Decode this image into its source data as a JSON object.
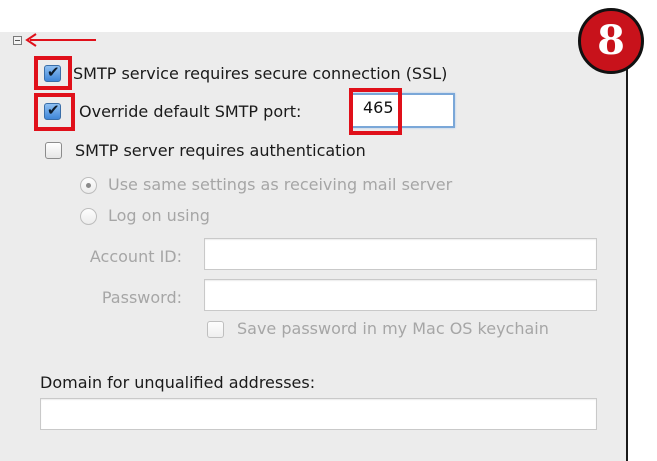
{
  "badge": "8",
  "ssl": {
    "label": "SMTP service requires secure connection (SSL)",
    "checked": true
  },
  "override_port": {
    "label": "Override default SMTP port:",
    "checked": true,
    "value": "465"
  },
  "auth": {
    "label": "SMTP server requires authentication",
    "checked": false
  },
  "radio_same": {
    "label": "Use same settings as receiving mail server",
    "selected": true
  },
  "radio_logon": {
    "label": "Log on using",
    "selected": false
  },
  "account_id": {
    "label": "Account ID:",
    "value": ""
  },
  "password": {
    "label": "Password:",
    "value": ""
  },
  "keychain": {
    "label": "Save password in my Mac OS keychain",
    "checked": false
  },
  "domain": {
    "label": "Domain for unqualified addresses:",
    "value": ""
  },
  "colors": {
    "highlight": "#e0101a",
    "badge": "#c8121b"
  }
}
